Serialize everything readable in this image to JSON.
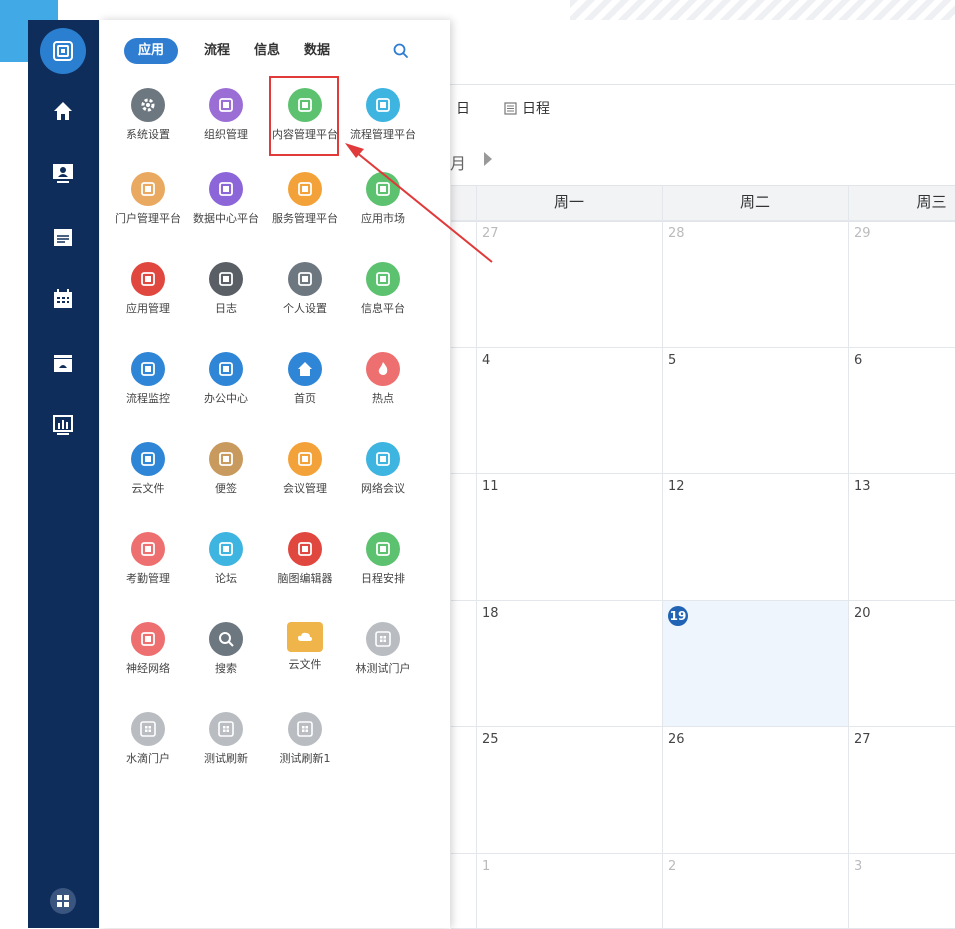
{
  "colors": {
    "rail": "#0f2d5a",
    "accent": "#2e7dd1",
    "highlight": "#e03a3a",
    "today": "#2062b4"
  },
  "rail": {
    "logo_icon": "app-logo-icon",
    "items": [
      "home-icon",
      "user-screen-icon",
      "news-icon",
      "calendar-icon",
      "folder-icon",
      "chart-icon"
    ],
    "bottom_icon": "apps-grid-icon"
  },
  "tabs": {
    "items": [
      "应用",
      "流程",
      "信息",
      "数据"
    ],
    "active": "应用",
    "search_icon": "search-icon"
  },
  "apps": [
    {
      "label": "系统设置",
      "icon": "gear-icon",
      "color": "#6d7780"
    },
    {
      "label": "组织管理",
      "icon": "org-icon",
      "color": "#9b6ed6"
    },
    {
      "label": "内容管理平台",
      "icon": "content-icon",
      "color": "#5cc26f"
    },
    {
      "label": "流程管理平台",
      "icon": "flow-icon",
      "color": "#3eb4e0"
    },
    {
      "label": "门户管理平台",
      "icon": "portal-icon",
      "color": "#eaa960"
    },
    {
      "label": "数据中心平台",
      "icon": "data-icon",
      "color": "#8c66d8"
    },
    {
      "label": "服务管理平台",
      "icon": "service-icon",
      "color": "#f3a23a"
    },
    {
      "label": "应用市场",
      "icon": "shop-icon",
      "color": "#5cc26f"
    },
    {
      "label": "应用管理",
      "icon": "app-manage-icon",
      "color": "#e0473e"
    },
    {
      "label": "日志",
      "icon": "log-icon",
      "color": "#5a5f66"
    },
    {
      "label": "个人设置",
      "icon": "user-settings-icon",
      "color": "#6d7780"
    },
    {
      "label": "信息平台",
      "icon": "info-icon",
      "color": "#5cc26f"
    },
    {
      "label": "流程监控",
      "icon": "monitor-icon",
      "color": "#2f86d6"
    },
    {
      "label": "办公中心",
      "icon": "office-icon",
      "color": "#2f86d6"
    },
    {
      "label": "首页",
      "icon": "home-icon",
      "color": "#2f86d6"
    },
    {
      "label": "热点",
      "icon": "fire-icon",
      "color": "#ee6f6f"
    },
    {
      "label": "云文件",
      "icon": "cloud-file-icon",
      "color": "#2f86d6"
    },
    {
      "label": "便签",
      "icon": "note-icon",
      "color": "#c99a5e"
    },
    {
      "label": "会议管理",
      "icon": "meeting-icon",
      "color": "#f3a23a"
    },
    {
      "label": "网络会议",
      "icon": "web-meeting-icon",
      "color": "#3eb4e0"
    },
    {
      "label": "考勤管理",
      "icon": "attendance-icon",
      "color": "#ee6f6f"
    },
    {
      "label": "论坛",
      "icon": "forum-icon",
      "color": "#3eb4e0"
    },
    {
      "label": "脑图编辑器",
      "icon": "mindmap-icon",
      "color": "#e0473e"
    },
    {
      "label": "日程安排",
      "icon": "schedule-icon",
      "color": "#5cc26f"
    },
    {
      "label": "神经网络",
      "icon": "brain-icon",
      "color": "#ee6f6f"
    },
    {
      "label": "搜索",
      "icon": "search-icon",
      "color": "#6d7780"
    },
    {
      "label": "云文件",
      "icon": "folder-cloud-icon",
      "color": "#f0b54a"
    },
    {
      "label": "林测试门户",
      "icon": "grid-icon",
      "color": "#b9bdc2"
    },
    {
      "label": "水滴门户",
      "icon": "grid-icon",
      "color": "#b9bdc2"
    },
    {
      "label": "测试刷新",
      "icon": "grid-icon",
      "color": "#b9bdc2"
    },
    {
      "label": "测试刷新1",
      "icon": "grid-icon",
      "color": "#b9bdc2"
    }
  ],
  "calendar": {
    "view_day": "日",
    "view_schedule": "日程",
    "nav_label": "月",
    "weekdays": [
      "周一",
      "周二",
      "周三"
    ],
    "rows": [
      [
        "27",
        "28",
        "29"
      ],
      [
        "4",
        "5",
        "6"
      ],
      [
        "11",
        "12",
        "13"
      ],
      [
        "18",
        "19",
        "20"
      ],
      [
        "25",
        "26",
        "27"
      ],
      [
        "1",
        "2",
        "3"
      ]
    ],
    "today": "19"
  }
}
